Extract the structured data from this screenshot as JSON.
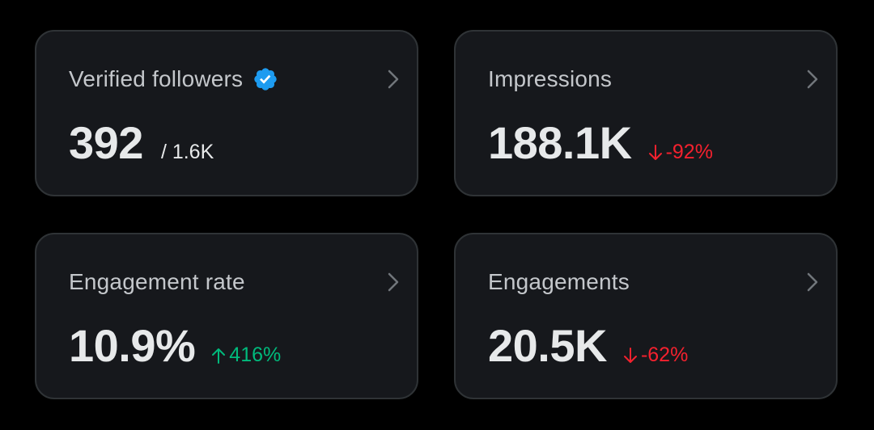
{
  "colors": {
    "background": "#000000",
    "card": "#16181c",
    "border": "#2f3336",
    "verified": "#1d9bf0",
    "negative": "#f4212e",
    "positive": "#00ba7c"
  },
  "cards": [
    {
      "title": "Verified followers",
      "icon": "verified-badge-icon",
      "value": "392",
      "total": "/ 1.6K"
    },
    {
      "title": "Impressions",
      "value": "188.1K",
      "change": "-92%",
      "trend": "down"
    },
    {
      "title": "Engagement rate",
      "value": "10.9%",
      "change": "416%",
      "trend": "up"
    },
    {
      "title": "Engagements",
      "value": "20.5K",
      "change": "-62%",
      "trend": "down"
    }
  ]
}
